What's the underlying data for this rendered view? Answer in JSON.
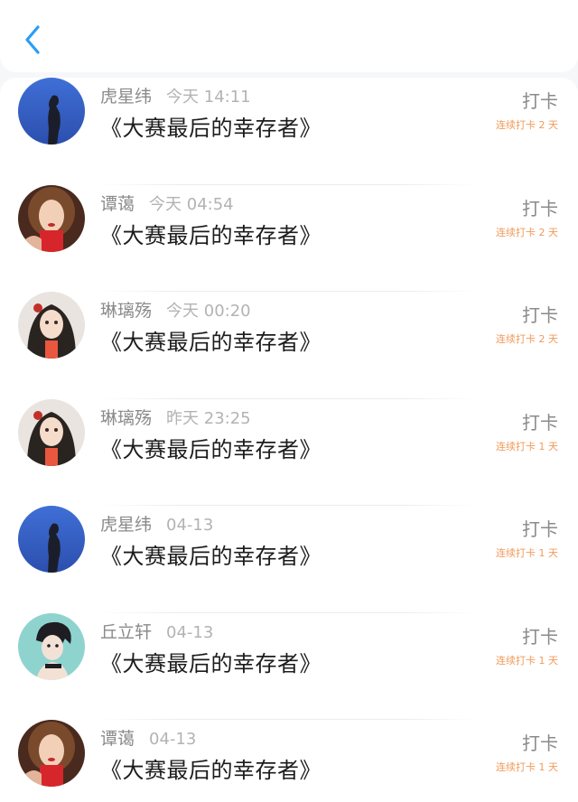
{
  "nav": {
    "back_icon": "chevron-left-icon",
    "accent_color": "#2a9df4"
  },
  "colors": {
    "streak": "#f09a5a",
    "name": "#8a8a8a",
    "time": "#b3b3b3"
  },
  "entries": [
    {
      "name": "虎星纬",
      "time": "今天 14:11",
      "book": "《大赛最后的幸存者》",
      "action": "打卡",
      "streak": "连续打卡 2 天",
      "avatar": "silhouette-sky"
    },
    {
      "name": "谭蔼",
      "time": "今天 04:54",
      "book": "《大赛最后的幸存者》",
      "action": "打卡",
      "streak": "连续打卡 2 天",
      "avatar": "woman-red"
    },
    {
      "name": "琳璃殇",
      "time": "今天 00:20",
      "book": "《大赛最后的幸存者》",
      "action": "打卡",
      "streak": "连续打卡 2 天",
      "avatar": "anime-girl"
    },
    {
      "name": "琳璃殇",
      "time": "昨天 23:25",
      "book": "《大赛最后的幸存者》",
      "action": "打卡",
      "streak": "连续打卡 1 天",
      "avatar": "anime-girl"
    },
    {
      "name": "虎星纬",
      "time": "04-13",
      "book": "《大赛最后的幸存者》",
      "action": "打卡",
      "streak": "连续打卡 1 天",
      "avatar": "silhouette-sky"
    },
    {
      "name": "丘立轩",
      "time": "04-13",
      "book": "《大赛最后的幸存者》",
      "action": "打卡",
      "streak": "连续打卡 1 天",
      "avatar": "anime-boy"
    },
    {
      "name": "谭蔼",
      "time": "04-13",
      "book": "《大赛最后的幸存者》",
      "action": "打卡",
      "streak": "连续打卡 1 天",
      "avatar": "woman-red"
    }
  ]
}
